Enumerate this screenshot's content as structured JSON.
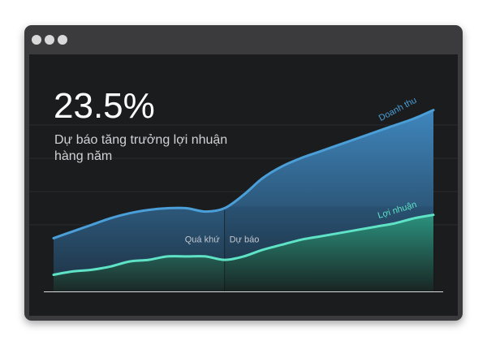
{
  "window": {
    "controls": [
      "close",
      "minimize",
      "maximize"
    ]
  },
  "headline": {
    "value": "23.5%",
    "caption": "Dự báo tăng trưởng lợi nhuận hàng năm"
  },
  "colors": {
    "revenue": "#4a9fd8",
    "profit": "#5fe3c6",
    "background": "#1b1c1e",
    "frame": "#3b3b3d"
  },
  "chart_data": {
    "type": "area",
    "title": "",
    "xlabel": "",
    "ylabel": "",
    "grid": true,
    "x": [
      0,
      1,
      2,
      3,
      4,
      5,
      6,
      7,
      8,
      9,
      10,
      11,
      12,
      13,
      14,
      15,
      16,
      17,
      18,
      19,
      20
    ],
    "ylim": [
      0,
      100
    ],
    "divider_x": 9,
    "annotations": {
      "past": "Quá khứ",
      "forecast": "Dự báo"
    },
    "series": [
      {
        "name": "Doanh thu",
        "values": [
          32,
          36,
          40,
          44,
          47,
          49,
          50,
          50,
          48,
          50,
          58,
          68,
          75,
          80,
          84,
          88,
          92,
          96,
          100,
          104,
          109
        ]
      },
      {
        "name": "Lợi nhuận",
        "values": [
          10,
          12,
          13,
          15,
          18,
          19,
          21,
          21,
          21,
          19,
          21,
          25,
          28,
          31,
          33,
          35,
          37,
          39,
          41,
          44,
          46
        ]
      }
    ]
  }
}
